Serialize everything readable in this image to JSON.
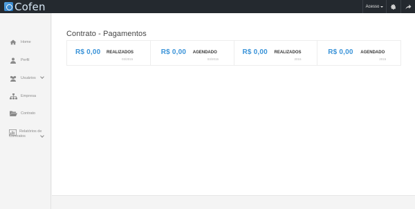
{
  "topbar": {
    "logo_text": "Cofen",
    "acesso_label": "Acesso",
    "icons": [
      "gear-icon",
      "logout-icon"
    ]
  },
  "sidebar": {
    "items": [
      {
        "label": "Home",
        "icon": "home-icon"
      },
      {
        "label": "Perfil",
        "icon": "user-icon"
      },
      {
        "label": "Usuários",
        "icon": "users-icon",
        "has_chevron": true
      },
      {
        "label": "Empresa",
        "icon": "sitemap-icon"
      },
      {
        "label": "Contrato",
        "icon": "folder-open-icon"
      },
      {
        "label": "Relatórios de",
        "label2": "Contratos",
        "icon": "bar-chart-icon",
        "has_chevron": true
      }
    ]
  },
  "main": {
    "title": "Contrato - Pagamentos",
    "stats": [
      {
        "amount": "R$ 0,00",
        "label": "REALIZADOS",
        "period": "03/2015"
      },
      {
        "amount": "R$ 0,00",
        "label": "AGENDADO",
        "period": "03/2015"
      },
      {
        "amount": "R$ 0,00",
        "label": "REALIZADOS",
        "period": "2015"
      },
      {
        "amount": "R$ 0,00",
        "label": "AGENDADO",
        "period": "2015"
      }
    ]
  },
  "colors": {
    "topbar_bg": "#24292f",
    "accent": "#3a93d8",
    "sidebar_bg": "#f4f4f4"
  }
}
